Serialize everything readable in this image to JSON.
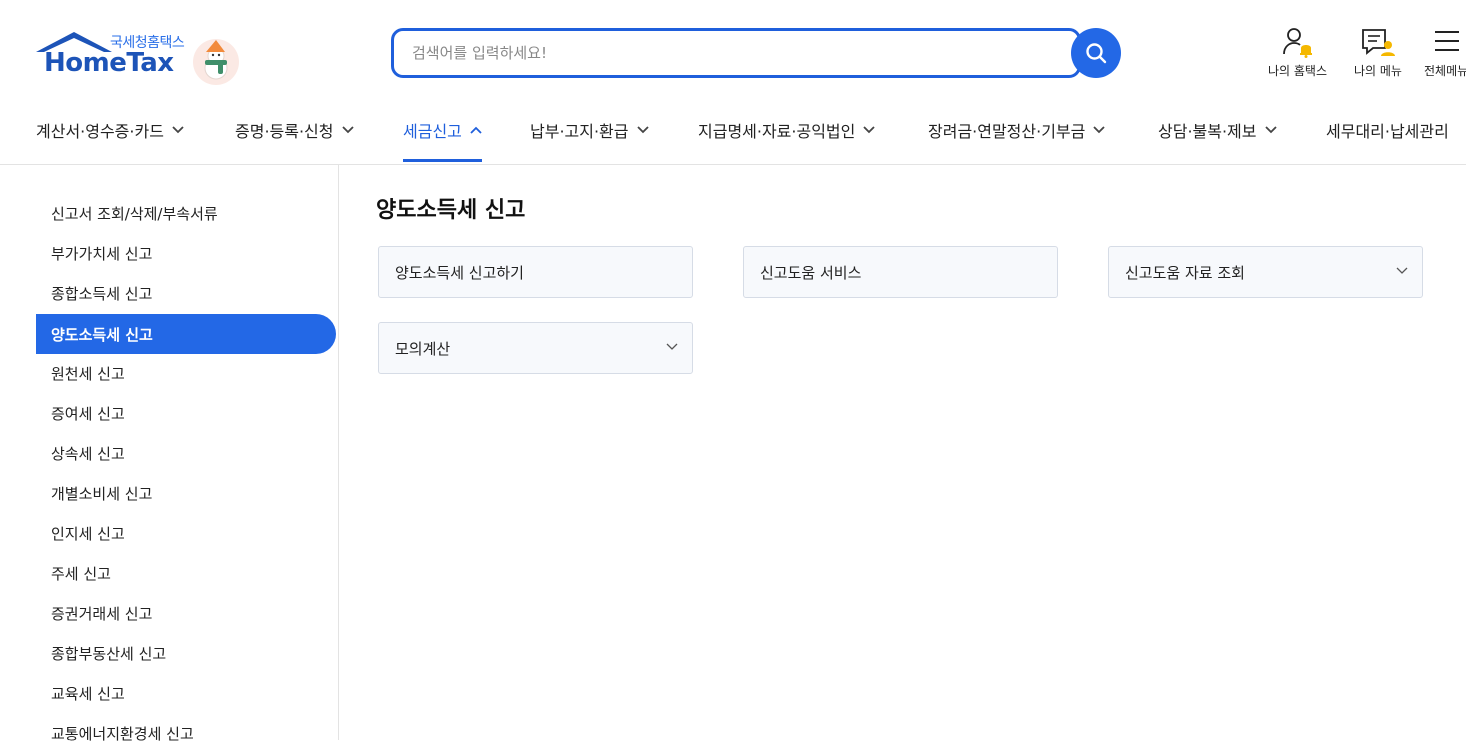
{
  "header": {
    "logo_sub": "국세청홈택스",
    "logo_main": "HomeTax",
    "search_placeholder": "검색어를 입력하세요!",
    "util": [
      {
        "label": "나의 홈택스",
        "icon": "user-bell-icon"
      },
      {
        "label": "나의 메뉴",
        "icon": "doc-user-icon"
      },
      {
        "label": "전체메뉴",
        "icon": "hamburger-icon"
      }
    ],
    "colors": {
      "brand": "#1d54b8",
      "accent": "#2368e6"
    }
  },
  "gnb": [
    {
      "label": "계산서·영수증·카드",
      "active": false
    },
    {
      "label": "증명·등록·신청",
      "active": false
    },
    {
      "label": "세금신고",
      "active": true
    },
    {
      "label": "납부·고지·환급",
      "active": false
    },
    {
      "label": "지급명세·자료·공익법인",
      "active": false
    },
    {
      "label": "장려금·연말정산·기부금",
      "active": false
    },
    {
      "label": "상담·불복·제보",
      "active": false
    },
    {
      "label": "세무대리·납세관리",
      "active": false
    }
  ],
  "sidebar": {
    "items": [
      {
        "label": "신고서 조회/삭제/부속서류"
      },
      {
        "label": "부가가치세 신고"
      },
      {
        "label": "종합소득세 신고"
      },
      {
        "label": "양도소득세 신고",
        "active": true
      },
      {
        "label": "원천세 신고"
      },
      {
        "label": "증여세 신고"
      },
      {
        "label": "상속세 신고"
      },
      {
        "label": "개별소비세 신고"
      },
      {
        "label": "인지세 신고"
      },
      {
        "label": "주세 신고"
      },
      {
        "label": "증권거래세 신고"
      },
      {
        "label": "종합부동산세 신고"
      },
      {
        "label": "교육세 신고"
      },
      {
        "label": "교통에너지환경세 신고"
      }
    ]
  },
  "main": {
    "title": "양도소득세 신고",
    "cards": [
      {
        "label": "양도소득세 신고하기",
        "expandable": false
      },
      {
        "label": "신고도움 서비스",
        "expandable": false
      },
      {
        "label": "신고도움 자료 조회",
        "expandable": true
      },
      {
        "label": "모의계산",
        "expandable": true
      }
    ]
  }
}
